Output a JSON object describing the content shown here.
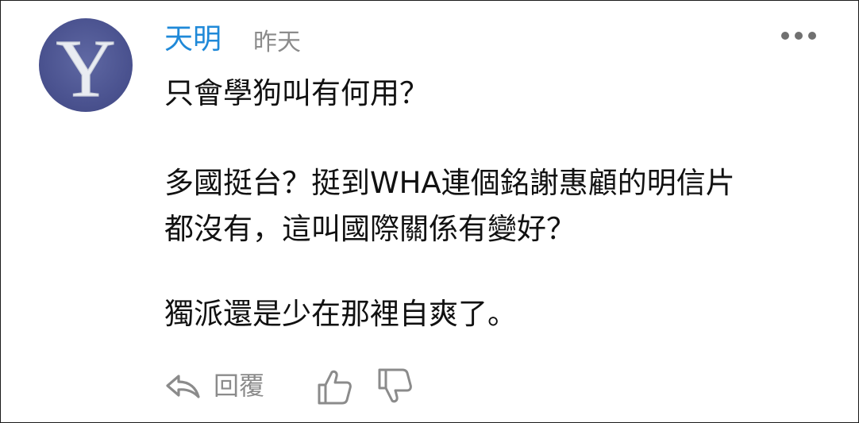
{
  "comment": {
    "author": "天明",
    "time": "昨天",
    "paragraphs": [
      "只會學狗叫有何用？",
      "多國挺台？挺到WHA連個銘謝惠顧的明信片\n都沒有，這叫國際關係有變好？",
      "獨派還是少在那裡自爽了。"
    ],
    "avatar_letter": "Y"
  },
  "actions": {
    "reply_label": "回覆"
  },
  "icons": {
    "avatar": "avatar-y-icon",
    "more": "more-dots-icon",
    "reply": "reply-arrow-icon",
    "like": "thumbs-up-icon",
    "dislike": "thumbs-down-icon"
  },
  "colors": {
    "author": "#1f89d8",
    "meta": "#8b8b8b",
    "text": "#111111",
    "avatar_bg": "#4b5390"
  }
}
